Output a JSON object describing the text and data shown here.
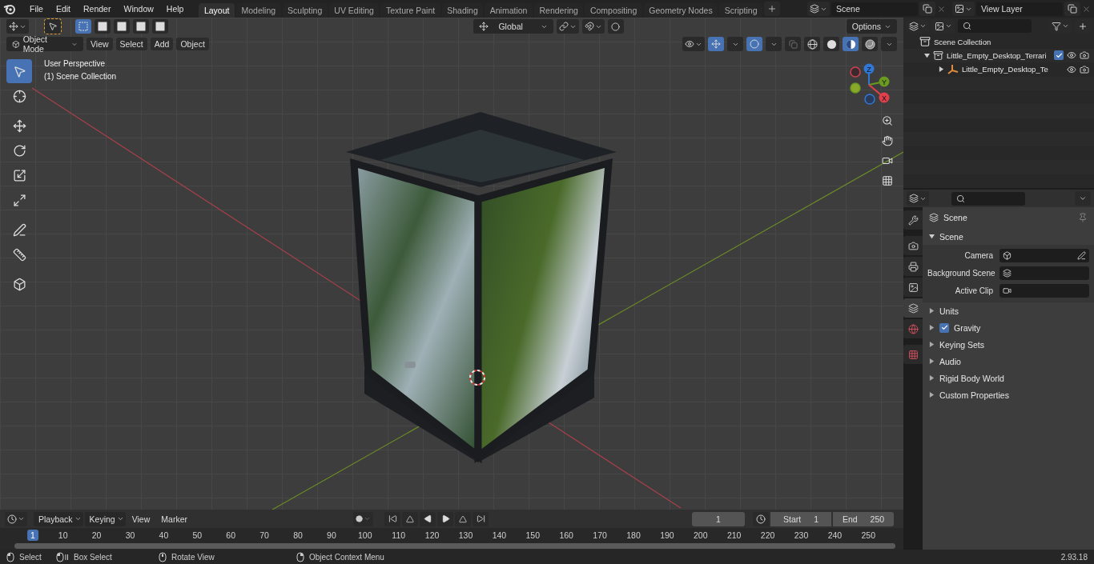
{
  "menu": [
    "File",
    "Edit",
    "Render",
    "Window",
    "Help"
  ],
  "workspaces": [
    {
      "label": "Layout",
      "selected": true
    },
    {
      "label": "Modeling",
      "selected": false
    },
    {
      "label": "Sculpting",
      "selected": false
    },
    {
      "label": "UV Editing",
      "selected": false
    },
    {
      "label": "Texture Paint",
      "selected": false
    },
    {
      "label": "Shading",
      "selected": false
    },
    {
      "label": "Animation",
      "selected": false
    },
    {
      "label": "Rendering",
      "selected": false
    },
    {
      "label": "Compositing",
      "selected": false
    },
    {
      "label": "Geometry Nodes",
      "selected": false
    },
    {
      "label": "Scripting",
      "selected": false
    }
  ],
  "scene": {
    "value": "Scene"
  },
  "view_layer": {
    "value": "View Layer"
  },
  "viewport": {
    "select_modes": [
      {
        "selected": true
      },
      {
        "selected": false
      },
      {
        "selected": false
      },
      {
        "selected": false
      },
      {
        "selected": false
      }
    ],
    "orientation": "Global",
    "options": "Options",
    "mode": "Object Mode",
    "menus": [
      "View",
      "Select",
      "Add",
      "Object"
    ],
    "shading": [
      {
        "kind": "wireframe",
        "selected": false
      },
      {
        "kind": "solid",
        "selected": false
      },
      {
        "kind": "material",
        "selected": true
      },
      {
        "kind": "rendered",
        "selected": false
      }
    ],
    "info": [
      "User Perspective",
      "(1) Scene Collection"
    ],
    "tools": [
      {
        "kind": "select",
        "selected": true
      },
      {
        "kind": "cursor",
        "selected": false
      },
      {
        "kind": "move",
        "selected": false
      },
      {
        "kind": "rotate",
        "selected": false
      },
      {
        "kind": "scale",
        "selected": false
      },
      {
        "kind": "transform",
        "selected": false
      },
      {
        "kind": "annotate",
        "selected": false
      },
      {
        "kind": "measure",
        "selected": false
      },
      {
        "kind": "add-cube",
        "selected": false
      }
    ],
    "gizmo_axes": [
      {
        "label": "Z",
        "color": "#2f78d6"
      },
      {
        "label": "Y",
        "color": "#6a9a1f"
      },
      {
        "label": "X",
        "color": "#e0404c"
      }
    ]
  },
  "outliner": {
    "root": "Scene Collection",
    "items": [
      {
        "label": "Little_Empty_Desktop_Terrari",
        "expanded": true,
        "checked": true,
        "children": [
          {
            "label": "Little_Empty_Desktop_Te",
            "expanded": false
          }
        ]
      }
    ]
  },
  "properties": {
    "tabs": [
      {
        "kind": "tool",
        "selected": false
      },
      {
        "kind": "render",
        "selected": false
      },
      {
        "kind": "output",
        "selected": false
      },
      {
        "kind": "view-layer",
        "selected": false
      },
      {
        "kind": "scene",
        "selected": true
      },
      {
        "kind": "world",
        "selected": false
      },
      {
        "kind": "texture",
        "selected": false
      }
    ],
    "context": "Scene",
    "panel": {
      "title": "Scene",
      "expanded": true,
      "fields": [
        {
          "label": "Camera",
          "kind": "camera"
        },
        {
          "label": "Background Scene",
          "kind": "scene"
        },
        {
          "label": "Active Clip",
          "kind": "clip"
        }
      ]
    },
    "sections": [
      {
        "label": "Units",
        "kind": "plain",
        "expanded": false
      },
      {
        "label": "Gravity",
        "kind": "checkbox",
        "checked": true,
        "expanded": false
      },
      {
        "label": "Keying Sets",
        "kind": "plain",
        "expanded": false
      },
      {
        "label": "Audio",
        "kind": "plain",
        "expanded": false
      },
      {
        "label": "Rigid Body World",
        "kind": "plain",
        "expanded": false
      },
      {
        "label": "Custom Properties",
        "kind": "plain",
        "expanded": false
      }
    ]
  },
  "timeline": {
    "menus": [
      {
        "label": "Playback",
        "dropdown": true
      },
      {
        "label": "Keying",
        "dropdown": true
      },
      {
        "label": "View",
        "dropdown": false
      },
      {
        "label": "Marker",
        "dropdown": false
      }
    ],
    "current_frame": "1",
    "start_label": "Start",
    "start": "1",
    "end_label": "End",
    "end": "250",
    "ruler": [
      {
        "label": "1",
        "selected": true
      },
      {
        "label": "10",
        "selected": false
      },
      {
        "label": "20",
        "selected": false
      },
      {
        "label": "30",
        "selected": false
      },
      {
        "label": "40",
        "selected": false
      },
      {
        "label": "50",
        "selected": false
      },
      {
        "label": "60",
        "selected": false
      },
      {
        "label": "70",
        "selected": false
      },
      {
        "label": "80",
        "selected": false
      },
      {
        "label": "90",
        "selected": false
      },
      {
        "label": "100",
        "selected": false
      },
      {
        "label": "110",
        "selected": false
      },
      {
        "label": "120",
        "selected": false
      },
      {
        "label": "130",
        "selected": false
      },
      {
        "label": "140",
        "selected": false
      },
      {
        "label": "150",
        "selected": false
      },
      {
        "label": "160",
        "selected": false
      },
      {
        "label": "170",
        "selected": false
      },
      {
        "label": "180",
        "selected": false
      },
      {
        "label": "190",
        "selected": false
      },
      {
        "label": "200",
        "selected": false
      },
      {
        "label": "210",
        "selected": false
      },
      {
        "label": "220",
        "selected": false
      },
      {
        "label": "230",
        "selected": false
      },
      {
        "label": "240",
        "selected": false
      },
      {
        "label": "250",
        "selected": false
      }
    ]
  },
  "status_bar": {
    "hints": [
      {
        "kind": "left-click",
        "label": "Select"
      },
      {
        "kind": "drag",
        "label": "Box Select"
      },
      {
        "kind": "middle-click",
        "label": "Rotate View"
      },
      {
        "kind": "right-click",
        "label": "Object Context Menu"
      }
    ],
    "version": "2.93.18"
  }
}
